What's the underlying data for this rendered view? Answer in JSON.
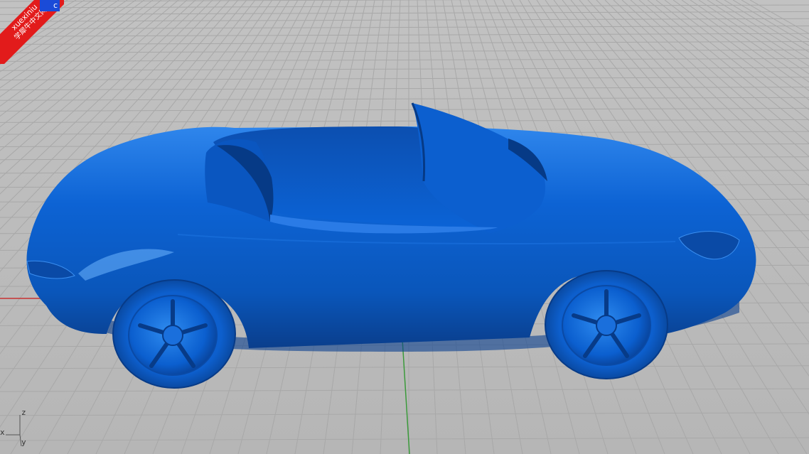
{
  "viewport": {
    "tab_label": "c",
    "background_color": "#bdbdbd",
    "grid_color": "#a9a9a9",
    "model_color": "#0a5fd6",
    "axis_x_color": "#c83232",
    "axis_y_color": "#3a9a3a"
  },
  "watermark": {
    "line1": "xuexiniu",
    "line2": "学犀牛中文网"
  },
  "axes_widget": {
    "x_label": "x",
    "y_label": "y",
    "z_label": "z"
  }
}
